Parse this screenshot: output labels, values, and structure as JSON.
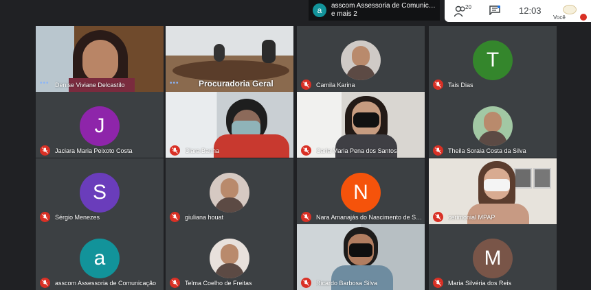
{
  "presenter": {
    "initial": "a",
    "line1": "asscom Assessoria de Comunic…",
    "line2": "e mais 2"
  },
  "topbar": {
    "people_count": "20",
    "clock": "12:03",
    "self_label": "Você"
  },
  "colors": {
    "red_mute": "#d93025",
    "tile_bg": "#3c4043",
    "page_bg": "#202124"
  },
  "tiles": [
    {
      "name": "Denise Viviane Delcastilo",
      "kind": "camera"
    },
    {
      "name": "",
      "kind": "camera",
      "caption": "Procuradoria Geral"
    },
    {
      "name": "Camila Karina",
      "kind": "photo",
      "muted": true
    },
    {
      "name": "Tais Dias",
      "kind": "letter",
      "letter": "T",
      "color": "#34862c",
      "muted": true
    },
    {
      "name": "Jaciara Maria Peixoto Costa",
      "kind": "letter",
      "letter": "J",
      "color": "#8e25aa",
      "muted": true
    },
    {
      "name": "Clara Banha",
      "kind": "camera",
      "muted": true
    },
    {
      "name": "Carla Maria Pena dos Santos",
      "kind": "camera",
      "muted": true
    },
    {
      "name": "Theila Soraia Costa da Silva",
      "kind": "photo",
      "muted": true
    },
    {
      "name": "Sérgio Menezes",
      "kind": "letter",
      "letter": "S",
      "color": "#6a3dbb",
      "muted": true
    },
    {
      "name": "giuliana houat",
      "kind": "photo",
      "muted": true
    },
    {
      "name": "Nara Amanajás do Nascimento de S…",
      "kind": "letter",
      "letter": "N",
      "color": "#f5530b",
      "muted": true
    },
    {
      "name": "cerimonial MPAP",
      "kind": "camera",
      "muted": true
    },
    {
      "name": "asscom Assessoria de Comunicação",
      "kind": "letter",
      "letter": "a",
      "color": "#12939a",
      "muted": true
    },
    {
      "name": "Telma Coelho de Freitas",
      "kind": "photo",
      "muted": true
    },
    {
      "name": "Ricardo Barbosa Silva",
      "kind": "camera",
      "muted": true
    },
    {
      "name": "Maria Silvéria dos Reis",
      "kind": "letter",
      "letter": "M",
      "color": "#795548",
      "muted": true
    }
  ]
}
